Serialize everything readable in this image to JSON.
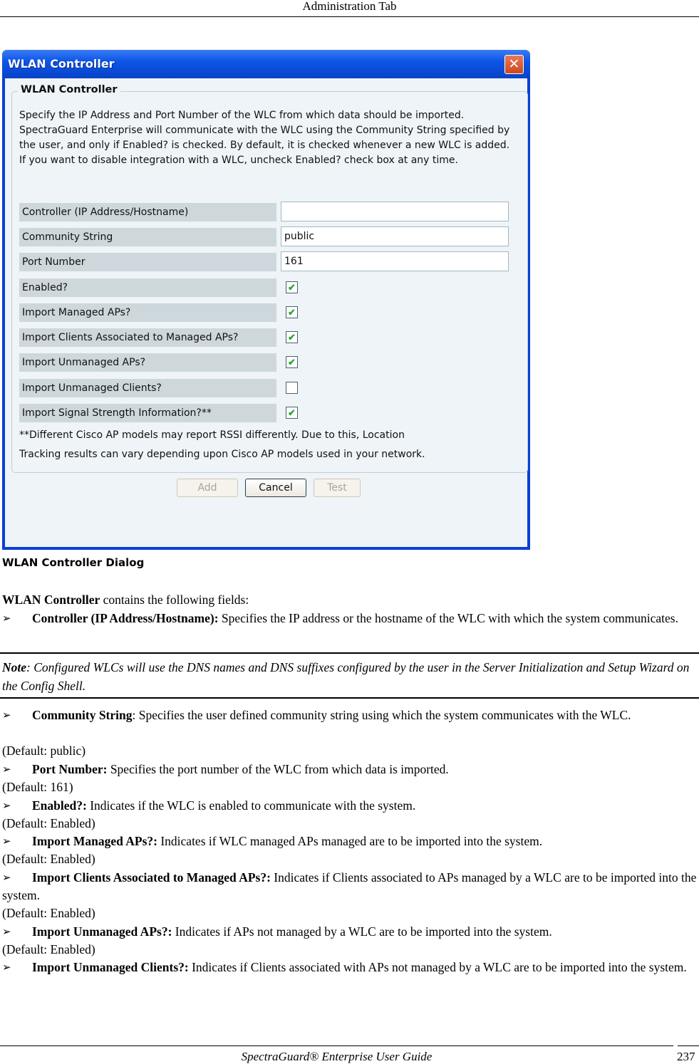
{
  "page": {
    "header": "Administration Tab",
    "footer_title": "SpectraGuard® Enterprise User Guide",
    "page_number": "237"
  },
  "dialog": {
    "title": "WLAN Controller",
    "close_icon": "close-icon",
    "group_title": "WLAN Controller",
    "description": "Specify the IP Address and Port Number of the WLC from which data should be imported. SpectraGuard Enterprise will communicate with the WLC using the Community String specified by the user, and only if Enabled? is checked. By default, it is checked whenever a new WLC is added. If you want to disable integration with a WLC, uncheck Enabled? check box at any time.",
    "fields": [
      {
        "label": "Controller (IP Address/Hostname)",
        "type": "text",
        "value": ""
      },
      {
        "label": "Community String",
        "type": "text",
        "value": "public"
      },
      {
        "label": "Port Number",
        "type": "text",
        "value": "161"
      },
      {
        "label": "Enabled?",
        "type": "checkbox",
        "checked": true
      },
      {
        "label": "Import Managed APs?",
        "type": "checkbox",
        "checked": true
      },
      {
        "label": "Import Clients Associated to Managed APs?",
        "type": "checkbox",
        "checked": true
      },
      {
        "label": "Import Unmanaged APs?",
        "type": "checkbox",
        "checked": true
      },
      {
        "label": "Import Unmanaged Clients?",
        "type": "checkbox",
        "checked": false
      },
      {
        "label": "Import Signal Strength Information?**",
        "type": "checkbox",
        "checked": true
      }
    ],
    "footnote_line1": "**Different Cisco AP models may report RSSI differently. Due to this, Location",
    "footnote_line2": "Tracking results can vary depending upon Cisco AP models used in your network.",
    "buttons": {
      "add": {
        "label": "Add",
        "enabled": false
      },
      "cancel": {
        "label": "Cancel",
        "enabled": true
      },
      "test": {
        "label": "Test",
        "enabled": false
      }
    }
  },
  "caption": "WLAN Controller Dialog",
  "doc": {
    "intro_bold": "WLAN Controller",
    "intro_rest": " contains the following fields:",
    "bullet_glyph": "➢",
    "note_label": "Note",
    "note_text": ": Configured WLCs will use the DNS names and DNS suffixes configured by the user in the Server Initialization and Setup Wizard on the Config Shell.",
    "items": [
      {
        "term": "Controller (IP Address/Hostname):",
        "desc": " Specifies the IP address or the hostname of the WLC with which the system communicates.",
        "default": ""
      },
      {
        "term": "Community String",
        "desc": ": Specifies the user defined community string using which the system communicates with the WLC.",
        "default": "(Default: public)"
      },
      {
        "term": "Port Number:",
        "desc": " Specifies the port number of the WLC from which data is imported.",
        "default": "(Default: 161)"
      },
      {
        "term": "Enabled?:",
        "desc": " Indicates if the WLC is enabled to communicate with the system.",
        "default": "(Default: Enabled)"
      },
      {
        "term": "Import Managed APs?:",
        "desc": " Indicates if WLC managed APs managed are to be imported into the system.",
        "default": "(Default: Enabled)"
      },
      {
        "term": "Import Clients Associated to Managed APs?:",
        "desc": " Indicates if Clients associated to APs managed by a WLC are to be imported into the system.",
        "default": "(Default: Enabled)"
      },
      {
        "term": "Import Unmanaged APs?:",
        "desc": " Indicates if APs not managed by a WLC are to be imported into the system.",
        "default": "(Default: Enabled)"
      },
      {
        "term": "Import Unmanaged Clients?:",
        "desc": " Indicates if Clients associated with APs not managed by a WLC are to be imported into the system.",
        "default": ""
      }
    ]
  }
}
